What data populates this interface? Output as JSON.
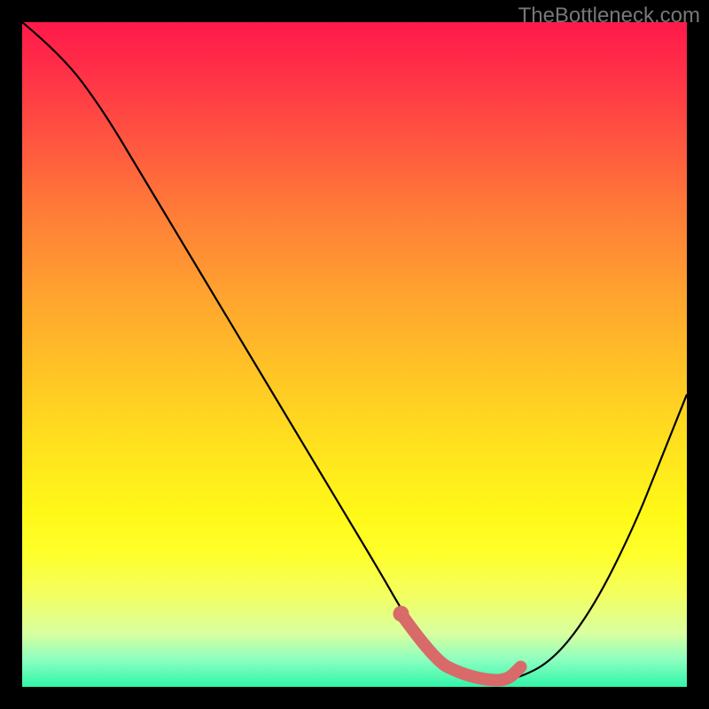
{
  "watermark": "TheBottleneck.com",
  "chart_data": {
    "type": "line",
    "title": "",
    "xlabel": "",
    "ylabel": "",
    "xlim": [
      0,
      100
    ],
    "ylim": [
      0,
      100
    ],
    "series": [
      {
        "name": "bottleneck-curve",
        "x": [
          0,
          6,
          12,
          18,
          24,
          30,
          36,
          42,
          48,
          54,
          58,
          62,
          66,
          70,
          74,
          80,
          86,
          92,
          96,
          100
        ],
        "values": [
          100,
          95,
          87,
          77,
          67,
          57,
          47,
          37,
          27,
          17,
          10,
          5,
          2,
          1,
          1,
          4,
          12,
          24,
          34,
          44
        ]
      }
    ],
    "highlight": {
      "name": "optimal-range",
      "x": [
        57,
        62,
        66,
        70,
        73,
        75
      ],
      "values": [
        11,
        4,
        2,
        1,
        1,
        3
      ]
    },
    "highlight_dot": {
      "x": 57,
      "value": 11
    },
    "colors": {
      "curve": "#000000",
      "highlight": "#d96a6a",
      "gradient_top": "#ff1a4a",
      "gradient_bottom": "#30f5a8"
    }
  }
}
